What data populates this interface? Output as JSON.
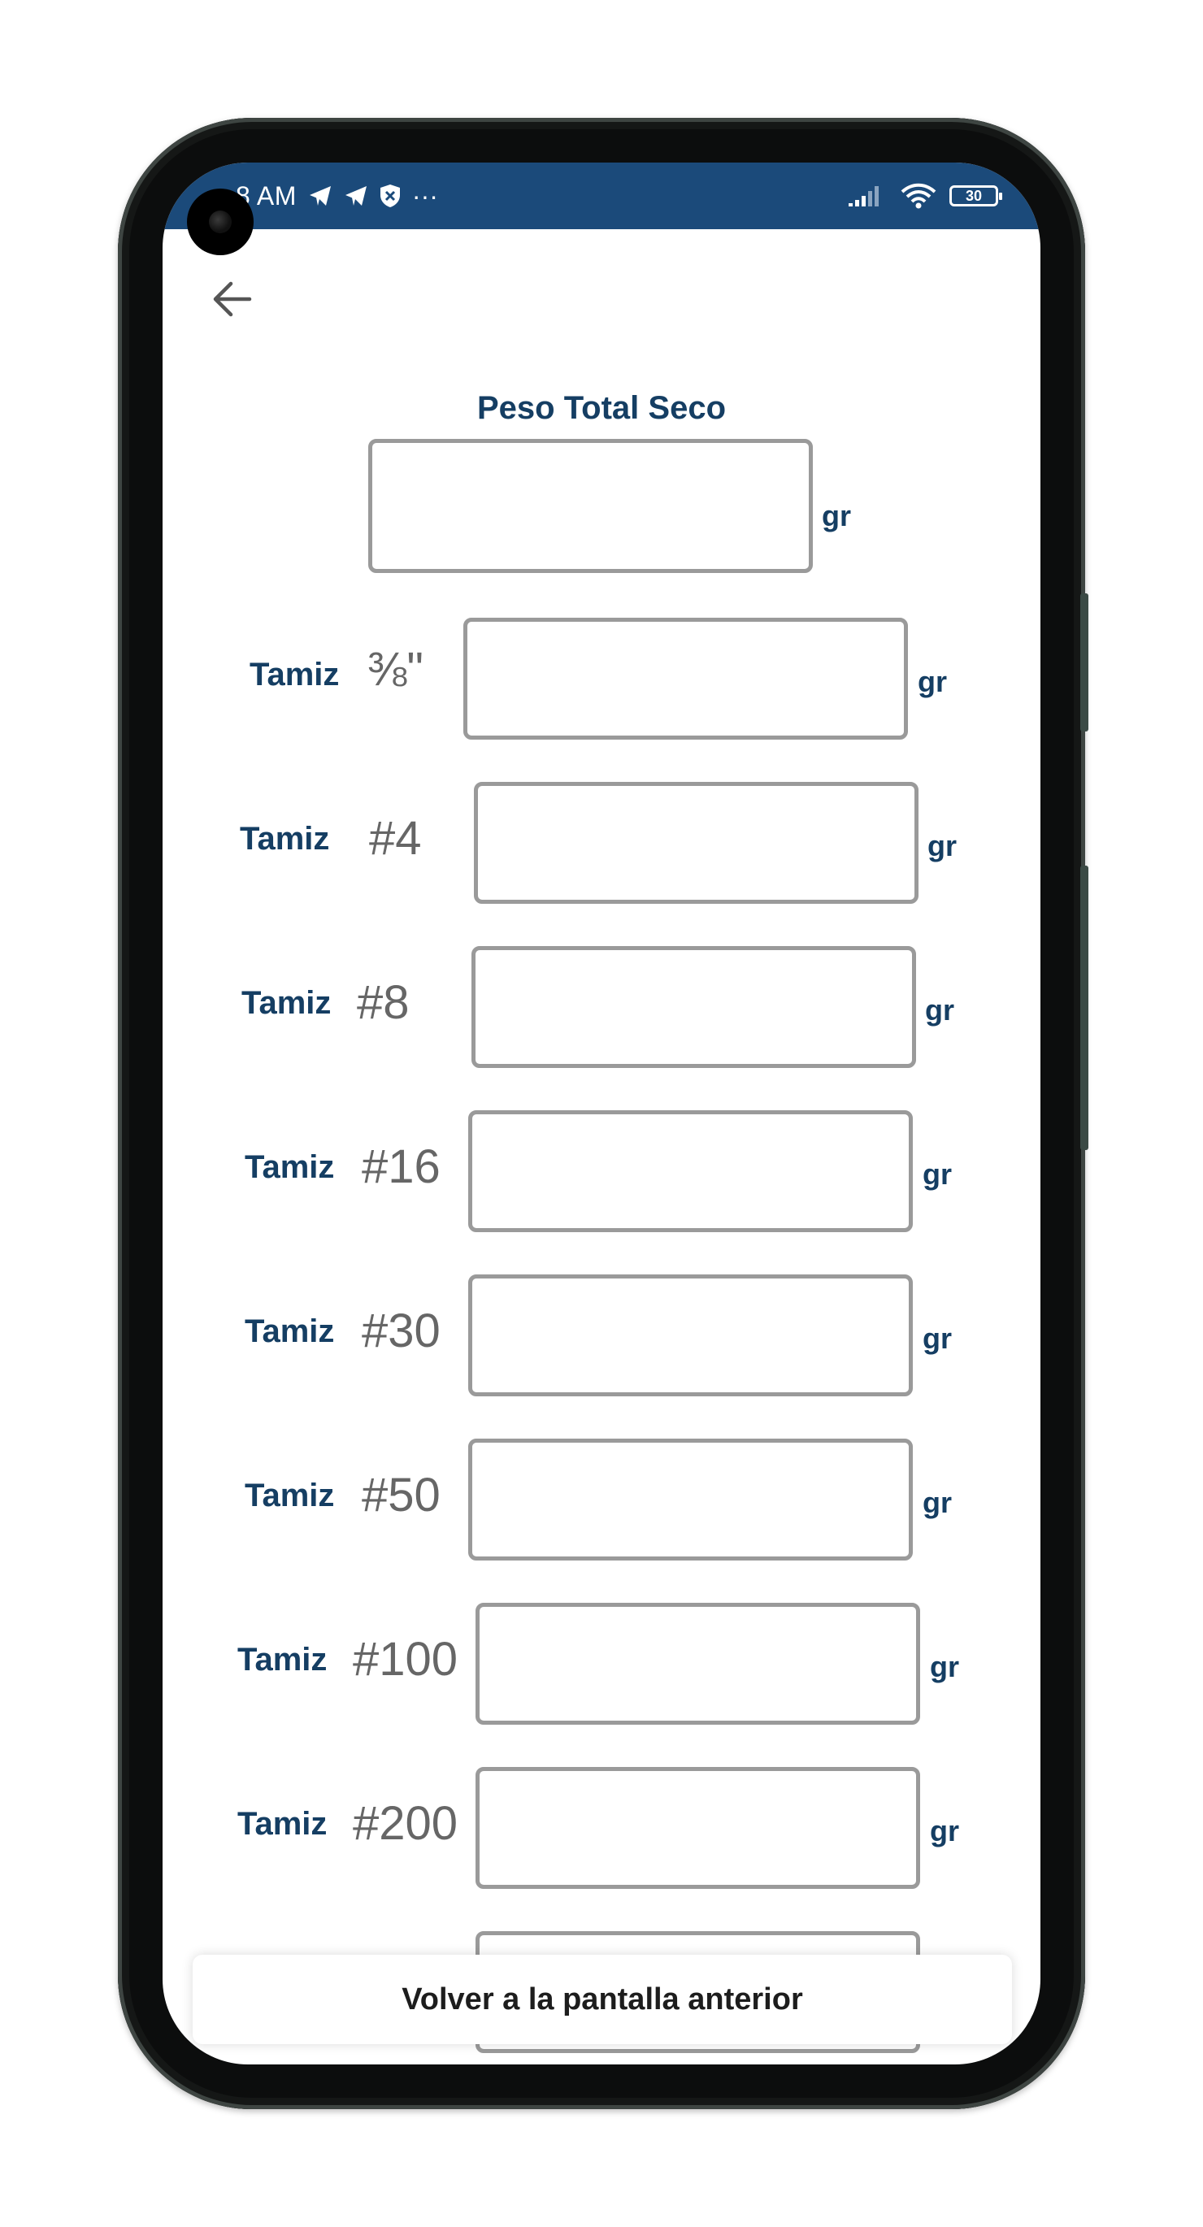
{
  "status_bar": {
    "time": "8 AM",
    "battery": "30",
    "overflow": "···"
  },
  "total": {
    "title": "Peso Total Seco",
    "value": "",
    "unit": "gr"
  },
  "sieves": [
    {
      "label": "Tamiz",
      "size": "⅜\"",
      "value": "",
      "unit": "gr"
    },
    {
      "label": "Tamiz",
      "size": "#4",
      "value": "",
      "unit": "gr"
    },
    {
      "label": "Tamiz",
      "size": "#8",
      "value": "",
      "unit": "gr"
    },
    {
      "label": "Tamiz",
      "size": "#16",
      "value": "",
      "unit": "gr"
    },
    {
      "label": "Tamiz",
      "size": "#30",
      "value": "",
      "unit": "gr"
    },
    {
      "label": "Tamiz",
      "size": "#50",
      "value": "",
      "unit": "gr"
    },
    {
      "label": "Tamiz",
      "size": "#100",
      "value": "",
      "unit": "gr"
    },
    {
      "label": "Tamiz",
      "size": "#200",
      "value": "",
      "unit": "gr"
    }
  ],
  "bottom_button": {
    "label": "Volver a la pantalla anterior"
  },
  "colors": {
    "status_bar": "#1b4a7a",
    "label_text": "#153e63",
    "sieve_text": "#666666",
    "input_border": "#9a9a9a"
  },
  "icons": {
    "back": "arrow-left-icon",
    "telegram": "telegram-icon",
    "shield": "shield-icon",
    "signal": "signal-icon",
    "wifi": "wifi-icon",
    "battery": "battery-icon"
  }
}
